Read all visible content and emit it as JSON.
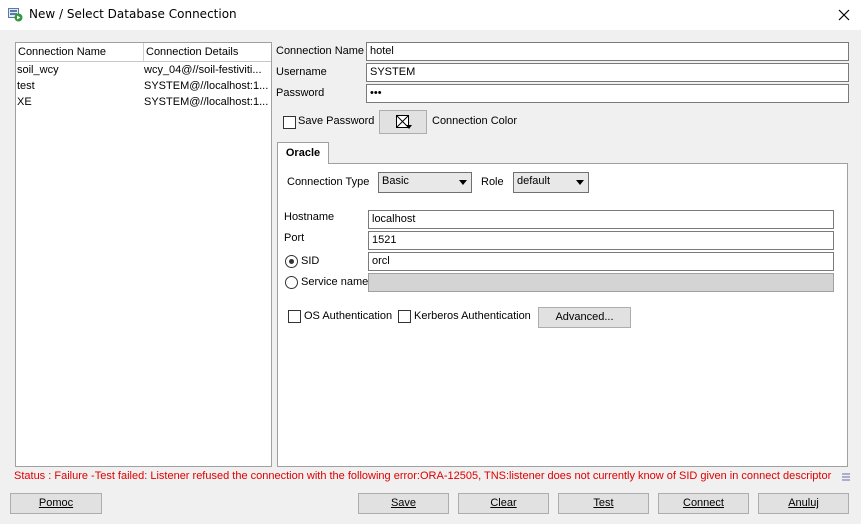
{
  "window": {
    "title": "New / Select Database Connection"
  },
  "connection_list": {
    "headers": [
      "Connection Name",
      "Connection Details"
    ],
    "rows": [
      {
        "name": "soil_wcy",
        "details": "wcy_04@//soil-festiviti..."
      },
      {
        "name": "test",
        "details": "SYSTEM@//localhost:1..."
      },
      {
        "name": "XE",
        "details": "SYSTEM@//localhost:1..."
      }
    ]
  },
  "form": {
    "connection_name_label": "Connection Name",
    "connection_name_value": "hotel",
    "username_label": "Username",
    "username_value": "SYSTEM",
    "password_label": "Password",
    "password_value": "•••",
    "save_password_label": "Save Password",
    "save_password_checked": false,
    "connection_color_label": "Connection Color"
  },
  "tabs": [
    {
      "label": "Oracle",
      "active": true
    }
  ],
  "oracle": {
    "connection_type_label": "Connection Type",
    "connection_type_value": "Basic",
    "role_label": "Role",
    "role_value": "default",
    "hostname_label": "Hostname",
    "hostname_value": "localhost",
    "port_label": "Port",
    "port_value": "1521",
    "sid_label": "SID",
    "sid_value": "orcl",
    "sid_selected": true,
    "service_name_label": "Service name",
    "service_name_value": "",
    "os_auth_label": "OS Authentication",
    "kerberos_auth_label": "Kerberos Authentication",
    "advanced_label": "Advanced..."
  },
  "status": {
    "text": "Status : Failure -Test failed: Listener refused the connection with the following error:ORA-12505, TNS:listener does not currently know of SID given in connect descriptor",
    "color": "#e00000"
  },
  "buttons": {
    "help": "Pomoc",
    "save": "Save",
    "clear": "Clear",
    "test": "Test",
    "connect": "Connect",
    "cancel": "Anuluj"
  }
}
